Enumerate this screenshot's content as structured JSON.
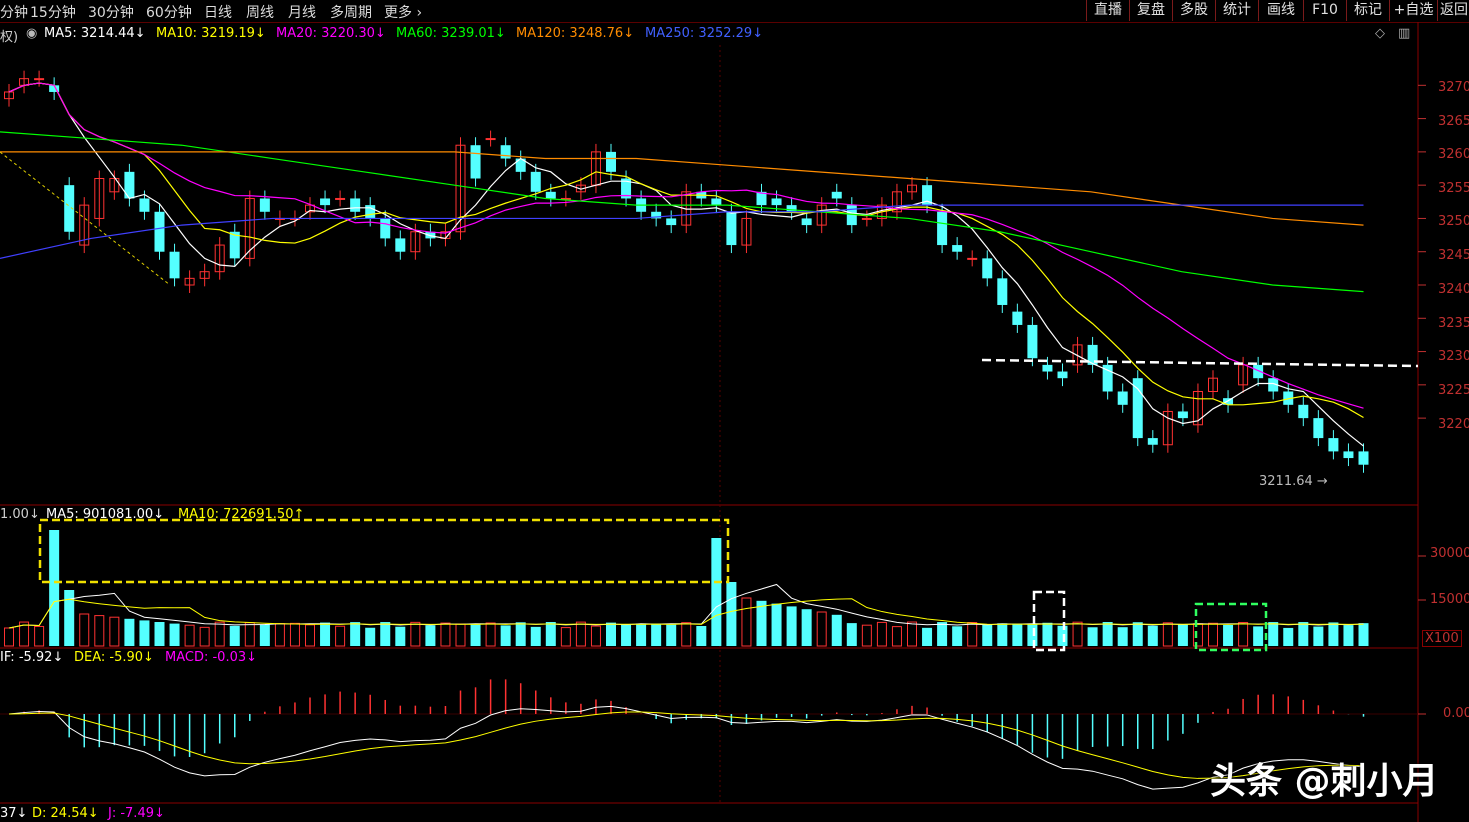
{
  "toolbar": {
    "timeframes": [
      "分钟",
      "15分钟",
      "30分钟",
      "60分钟",
      "日线",
      "周线",
      "月线",
      "多周期",
      "更多"
    ],
    "right_buttons": [
      "直播",
      "复盘",
      "多股",
      "统计",
      "画线",
      "F10",
      "标记",
      "+自选",
      "返回"
    ]
  },
  "price_panel": {
    "prefix": "权)",
    "ma5": "MA5: 3214.44",
    "ma10": "MA10: 3219.19",
    "ma20": "MA20: 3220.30",
    "ma60": "MA60: 3239.01",
    "ma120": "MA120: 3248.76",
    "ma250": "MA250: 3252.29",
    "min_label": "3211.64",
    "colors": {
      "ma5": "#ffffff",
      "ma10": "#ffff00",
      "ma20": "#ff00ff",
      "ma60": "#00ff00",
      "ma120": "#ff8c00",
      "ma250": "#4040ff"
    },
    "y_ticks": [
      "3270",
      "3265",
      "3260",
      "3255",
      "3250",
      "3245",
      "3240",
      "3235",
      "3230",
      "3225",
      "3220"
    ]
  },
  "volume_panel": {
    "prefix": "1.00",
    "ma5": "MA5: 901081.00",
    "ma10": "MA10: 722691.50",
    "y_ticks": [
      "30000",
      "15000"
    ],
    "unit": "X100"
  },
  "macd_panel": {
    "dif": "IF: -5.92",
    "dea": "DEA: -5.90",
    "macd": "MACD: -0.03",
    "zero_tick": "0.00"
  },
  "kdj_panel": {
    "k": "37",
    "d": "D: 24.54",
    "j": "J: -7.49"
  },
  "watermark": "头条 @刺小月",
  "chart_data": {
    "type": "candlestick",
    "title": "",
    "candles": [
      {
        "o": 3268,
        "c": 3269
      },
      {
        "o": 3270,
        "c": 3271
      },
      {
        "o": 3271,
        "c": 3271
      },
      {
        "o": 3270,
        "c": 3269
      },
      {
        "o": 3255,
        "c": 3248
      },
      {
        "o": 3246,
        "c": 3252
      },
      {
        "o": 3250,
        "c": 3256
      },
      {
        "o": 3254,
        "c": 3256
      },
      {
        "o": 3257,
        "c": 3253
      },
      {
        "o": 3253,
        "c": 3251
      },
      {
        "o": 3251,
        "c": 3245
      },
      {
        "o": 3245,
        "c": 3241
      },
      {
        "o": 3240,
        "c": 3241
      },
      {
        "o": 3241,
        "c": 3242
      },
      {
        "o": 3242,
        "c": 3246
      },
      {
        "o": 3248,
        "c": 3244
      },
      {
        "o": 3244,
        "c": 3253
      },
      {
        "o": 3253,
        "c": 3251
      },
      {
        "o": 3250,
        "c": 3250
      },
      {
        "o": 3250,
        "c": 3250
      },
      {
        "o": 3251,
        "c": 3252
      },
      {
        "o": 3253,
        "c": 3252
      },
      {
        "o": 3253,
        "c": 3253
      },
      {
        "o": 3253,
        "c": 3251
      },
      {
        "o": 3252,
        "c": 3250
      },
      {
        "o": 3250,
        "c": 3247
      },
      {
        "o": 3247,
        "c": 3245
      },
      {
        "o": 3245,
        "c": 3248
      },
      {
        "o": 3248,
        "c": 3247
      },
      {
        "o": 3247,
        "c": 3248
      },
      {
        "o": 3248,
        "c": 3261
      },
      {
        "o": 3261,
        "c": 3256
      },
      {
        "o": 3262,
        "c": 3262
      },
      {
        "o": 3261,
        "c": 3259
      },
      {
        "o": 3259,
        "c": 3257
      },
      {
        "o": 3257,
        "c": 3254
      },
      {
        "o": 3254,
        "c": 3253
      },
      {
        "o": 3253,
        "c": 3253
      },
      {
        "o": 3254,
        "c": 3255
      },
      {
        "o": 3255,
        "c": 3260
      },
      {
        "o": 3260,
        "c": 3257
      },
      {
        "o": 3256,
        "c": 3253
      },
      {
        "o": 3253,
        "c": 3251
      },
      {
        "o": 3251,
        "c": 3250
      },
      {
        "o": 3250,
        "c": 3249
      },
      {
        "o": 3249,
        "c": 3254
      },
      {
        "o": 3254,
        "c": 3253
      },
      {
        "o": 3253,
        "c": 3252
      },
      {
        "o": 3251,
        "c": 3246
      },
      {
        "o": 3246,
        "c": 3250
      },
      {
        "o": 3254,
        "c": 3252
      },
      {
        "o": 3253,
        "c": 3252
      },
      {
        "o": 3252,
        "c": 3251
      },
      {
        "o": 3250,
        "c": 3249
      },
      {
        "o": 3249,
        "c": 3252
      },
      {
        "o": 3254,
        "c": 3253
      },
      {
        "o": 3252,
        "c": 3249
      },
      {
        "o": 3250,
        "c": 3250
      },
      {
        "o": 3250,
        "c": 3252
      },
      {
        "o": 3251,
        "c": 3254
      },
      {
        "o": 3254,
        "c": 3255
      },
      {
        "o": 3255,
        "c": 3252
      },
      {
        "o": 3251,
        "c": 3246
      },
      {
        "o": 3246,
        "c": 3245
      },
      {
        "o": 3244,
        "c": 3244
      },
      {
        "o": 3244,
        "c": 3241
      },
      {
        "o": 3241,
        "c": 3237
      },
      {
        "o": 3236,
        "c": 3234
      },
      {
        "o": 3234,
        "c": 3229
      },
      {
        "o": 3228,
        "c": 3227
      },
      {
        "o": 3227,
        "c": 3226
      },
      {
        "o": 3228,
        "c": 3231
      },
      {
        "o": 3231,
        "c": 3228
      },
      {
        "o": 3228,
        "c": 3224
      },
      {
        "o": 3224,
        "c": 3222
      },
      {
        "o": 3226,
        "c": 3217
      },
      {
        "o": 3217,
        "c": 3216
      },
      {
        "o": 3216,
        "c": 3221
      },
      {
        "o": 3221,
        "c": 3220
      },
      {
        "o": 3219,
        "c": 3224
      },
      {
        "o": 3224,
        "c": 3226
      },
      {
        "o": 3223,
        "c": 3222
      },
      {
        "o": 3225,
        "c": 3228
      },
      {
        "o": 3228,
        "c": 3226
      },
      {
        "o": 3226,
        "c": 3224
      },
      {
        "o": 3224,
        "c": 3222
      },
      {
        "o": 3222,
        "c": 3220
      },
      {
        "o": 3220,
        "c": 3217
      },
      {
        "o": 3217,
        "c": 3215
      },
      {
        "o": 3215,
        "c": 3214
      },
      {
        "o": 3215,
        "c": 3213
      }
    ]
  }
}
